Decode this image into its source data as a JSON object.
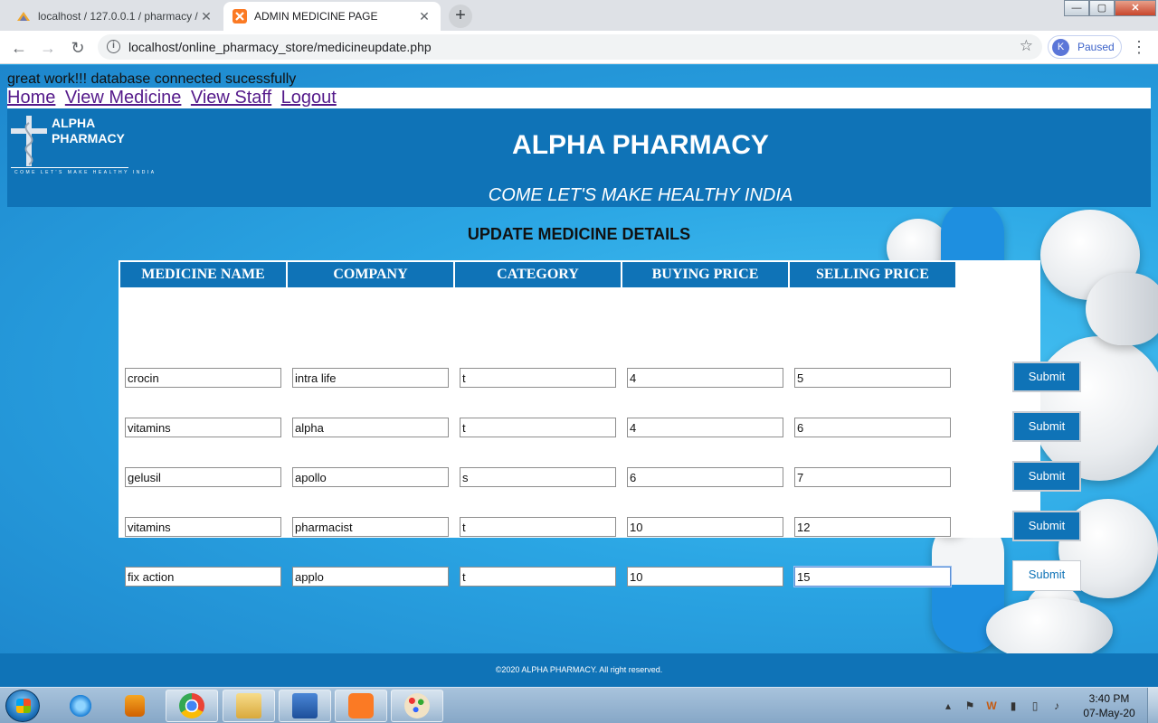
{
  "browser": {
    "tabs": [
      {
        "title": "localhost / 127.0.0.1 / pharmacy / ...",
        "active": false,
        "icon": "phpmyadmin-icon"
      },
      {
        "title": "ADMIN MEDICINE PAGE",
        "active": true,
        "icon": "xampp-icon"
      }
    ],
    "new_tab_glyph": "+",
    "url": "localhost/online_pharmacy_store/medicineupdate.php",
    "profile_initial": "K",
    "profile_status": "Paused",
    "window_controls": {
      "minimize": "—",
      "maximize": "▢",
      "close": "✕"
    }
  },
  "page": {
    "db_message": "great work!!! database connected sucessfully",
    "nav_links": [
      "Home",
      "View Medicine",
      "View Staff",
      "Logout"
    ],
    "logo": {
      "line1": "ALPHA",
      "line2": "PHARMACY",
      "tagline": "COME LET'S MAKE HEALTHY INDIA"
    },
    "site_title": "ALPHA PHARMACY",
    "site_tagline": "COME LET'S MAKE HEALTHY INDIA",
    "section_title": "UPDATE MEDICINE DETAILS",
    "table": {
      "headers": [
        "MEDICINE NAME",
        "COMPANY",
        "CATEGORY",
        "BUYING PRICE",
        "SELLING PRICE"
      ],
      "rows": [
        [
          "crocin",
          "intra life",
          "t",
          "4",
          "5"
        ],
        [
          "vitamins",
          "alpha",
          "t",
          "4",
          "6"
        ],
        [
          "gelusil",
          "apollo",
          "s",
          "6",
          "7"
        ],
        [
          "vitamins",
          "pharmacist",
          "t",
          "10",
          "12"
        ],
        [
          "fix action",
          "applo",
          "t",
          "10",
          "15"
        ]
      ],
      "submit_label": "Submit"
    },
    "footer": "©2020 ALPHA PHARMACY. All right reserved.",
    "colors": {
      "brand_blue": "#0f73b7",
      "background": "#2aa3e2",
      "link_visited": "#551a8b"
    }
  },
  "taskbar": {
    "items": [
      "start-orb",
      "internet-explorer-icon",
      "media-player-icon",
      "chrome-icon",
      "file-explorer-icon",
      "word-icon",
      "xampp-icon",
      "paint-icon"
    ],
    "time": "3:40 PM",
    "date": "07-May-20"
  }
}
